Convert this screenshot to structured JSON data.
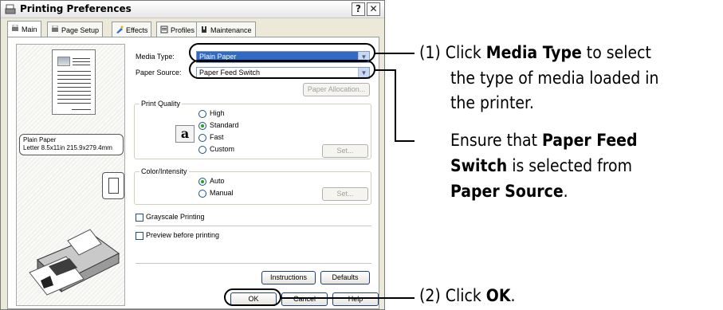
{
  "window": {
    "title": "Printing Preferences",
    "controls": {
      "help": "?",
      "close": "✕"
    }
  },
  "tabs": [
    {
      "label": "Main",
      "icon": "printer-tab-icon"
    },
    {
      "label": "Page Setup",
      "icon": "page-setup-icon"
    },
    {
      "label": "Effects",
      "icon": "effects-icon"
    },
    {
      "label": "Profiles",
      "icon": "profiles-icon"
    },
    {
      "label": "Maintenance",
      "icon": "maintenance-icon"
    }
  ],
  "preview": {
    "media_line": "Plain Paper",
    "size_line": "Letter 8.5x11in 215.9x279.4mm"
  },
  "media_type": {
    "label": "Media Type:",
    "value": "Plain Paper"
  },
  "paper_source": {
    "label": "Paper Source:",
    "value": "Paper Feed Switch"
  },
  "paper_allocation_button": "Paper Allocation...",
  "print_quality": {
    "title": "Print Quality",
    "icon_glyph": "a",
    "options": [
      "High",
      "Standard",
      "Fast",
      "Custom"
    ],
    "selected": "Standard",
    "set_button": "Set..."
  },
  "color_intensity": {
    "title": "Color/Intensity",
    "options": [
      "Auto",
      "Manual"
    ],
    "selected": "Auto",
    "set_button": "Set..."
  },
  "grayscale_label": "Grayscale Printing",
  "preview_label": "Preview before printing",
  "buttons": {
    "instructions": "Instructions",
    "defaults": "Defaults",
    "ok": "OK",
    "cancel": "Cancel",
    "help": "Help"
  },
  "annotations": {
    "step1_prefix": "(1) Click ",
    "step1_bold": "Media Type",
    "step1_rest": " to select",
    "step1_line2": "the type of media loaded in",
    "step1_line3_pre": "the printer",
    "step1_line3_post": ".",
    "ensure_line1_pre": "Ensure that ",
    "ensure_line1_bold": "Paper Feed",
    "ensure_line2_bold": "Switch",
    "ensure_line2_rest": " is selected from",
    "ensure_line3_bold": "Paper Source",
    "ensure_line3_post": ".",
    "step2_prefix": "(2) Click ",
    "step2_bold": "OK",
    "step2_post": "."
  }
}
